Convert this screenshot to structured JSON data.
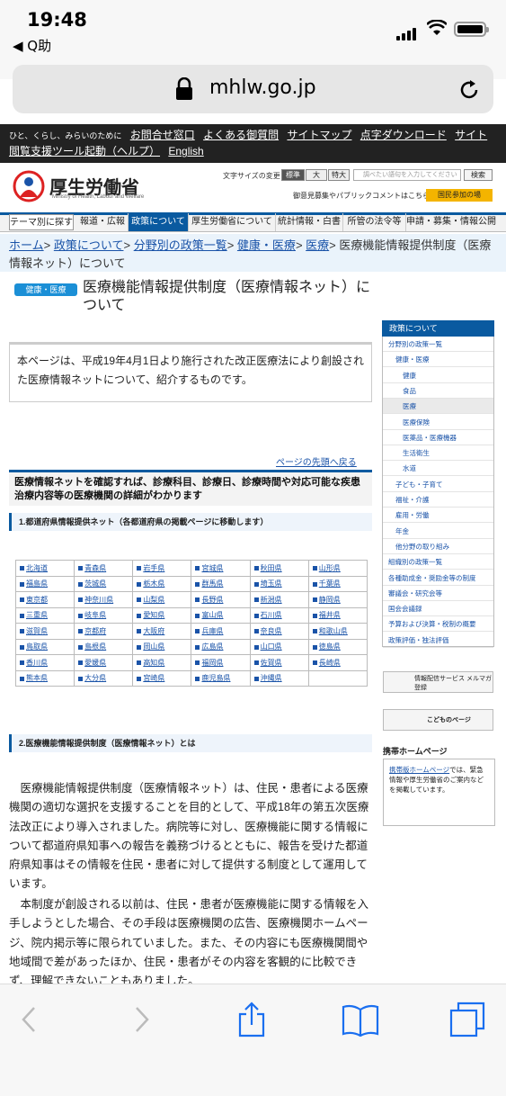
{
  "status": {
    "time": "19:48",
    "back_app": "◀ Q助"
  },
  "browser": {
    "url": "mhlw.go.jp"
  },
  "site": {
    "top_links": [
      "お問合せ窓口",
      "よくある御質問",
      "サイトマップ",
      "点字ダウンロード",
      "サイト閲覧支援ツール起動（ヘルプ）",
      "English"
    ],
    "slogan": "ひと、くらし、みらいのために",
    "logo_title": "厚生労働省",
    "logo_subtitle": "Ministry of Health, Labour and Welfare",
    "font_size_label": "文字サイズの変更",
    "font_sizes": [
      "標準",
      "大",
      "特大"
    ],
    "search_placeholder": "調べたい語句を入力してください",
    "search_button": "検索",
    "opinion_text": "御意見募集やパブリックコメントはこちら",
    "participate_button": "国民参加の場",
    "nav": [
      "テーマ別に探す",
      "報道・広報",
      "政策について",
      "厚生労働省について",
      "統計情報・白書",
      "所管の法令等",
      "申請・募集・情報公開"
    ],
    "breadcrumb": {
      "home": "ホーム",
      "policy": "政策について",
      "list": "分野別の政策一覧",
      "health": "健康・医療",
      "medical": "医療",
      "current": "医療機能情報提供制度（医療情報ネット）について"
    },
    "category_badge": "健康・医療",
    "page_title": "医療機能情報提供制度（医療情報ネット）について",
    "intro": "本ページは、平成19年4月1日より施行された改正医療法により創設された医療情報ネットについて、紹介するものです。",
    "page_top": "ページの先頭へ戻る",
    "lead": "医療情報ネットを確認すれば、診療科目、診療日、診療時間や対応可能な疾患治療内容等の医療機関の詳細がわかります",
    "section1": "1.都道府県情報提供ネット（各都道府県の掲載ページに移動します）",
    "prefectures": [
      [
        "北海道",
        "青森県",
        "岩手県",
        "宮城県",
        "秋田県",
        "山形県"
      ],
      [
        "福島県",
        "茨城県",
        "栃木県",
        "群馬県",
        "埼玉県",
        "千葉県"
      ],
      [
        "東京都",
        "神奈川県",
        "山梨県",
        "長野県",
        "新潟県",
        "静岡県"
      ],
      [
        "三重県",
        "岐阜県",
        "愛知県",
        "富山県",
        "石川県",
        "福井県"
      ],
      [
        "滋賀県",
        "京都府",
        "大阪府",
        "兵庫県",
        "奈良県",
        "和歌山県"
      ],
      [
        "鳥取県",
        "島根県",
        "岡山県",
        "広島県",
        "山口県",
        "徳島県"
      ],
      [
        "香川県",
        "愛媛県",
        "高知県",
        "福岡県",
        "佐賀県",
        "長崎県"
      ],
      [
        "熊本県",
        "大分県",
        "宮崎県",
        "鹿児島県",
        "沖縄県",
        ""
      ]
    ],
    "section2": "2.医療機能情報提供制度（医療情報ネット）とは",
    "body1": "医療機能情報提供制度（医療情報ネット）は、住民・患者による医療機関の適切な選択を支援することを目的として、平成18年の第五次医療法改正により導入されました。病院等に対し、医療機能に関する情報について都道府県知事への報告を義務づけるとともに、報告を受けた都道府県知事はその情報を住民・患者に対して提供する制度として運用しています。",
    "body2": "本制度が創設される以前は、住民・患者が医療機能に関する情報を入手しようとした場合、その手段は医療機関の広告、医療機関ホームページ、院内掲示等に限られていました。また、その内容にも医療機関間や地域間で差があったほか、住民・患者がその内容を客観的に比較できず、理解できないこともありました。",
    "sidebar": {
      "head": "政策について",
      "items": [
        "分野別の政策一覧",
        "健康・医療",
        "健康",
        "食品",
        "医療",
        "医療保険",
        "医薬品・医療機器",
        "生活衛生",
        "水道",
        "子ども・子育て",
        "福祉・介護",
        "雇用・労働",
        "年金",
        "他分野の取り組み",
        "組織別の政策一覧",
        "各種助成金・奨励金等の制度",
        "審議会・研究会等",
        "国会会議録",
        "予算および決算・税制の概要",
        "政策評価・独法評価"
      ]
    },
    "banner_mail": "情報配信サービス メルマガ登録",
    "banner_kids": "こどものページ",
    "mobile_head": "携帯ホームページ",
    "mobile_link": "携帯版ホームページ",
    "mobile_text": "では、緊急情報や厚生労働省のご案内などを掲載しています。"
  }
}
